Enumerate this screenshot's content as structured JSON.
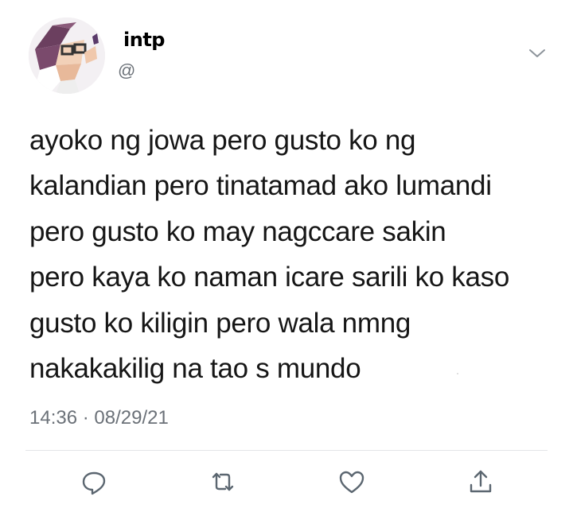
{
  "tweet": {
    "display_name": "intp",
    "handle": "@",
    "text_lines": [
      "ayoko ng jowa pero gusto ko ng",
      "kalandian pero tinatamad ako lumandi",
      "pero gusto ko may nagccare sakin",
      "pero kaya ko naman icare sarili ko kaso",
      "gusto ko kiligin pero wala nmng",
      "nakakakilig na tao s mundo"
    ],
    "time": "14:36",
    "separator": "·",
    "date": "08/29/21"
  },
  "icons": {
    "menu": "chevron-down-icon",
    "reply": "reply-icon",
    "retweet": "retweet-icon",
    "like": "heart-icon",
    "share": "share-icon"
  },
  "colors": {
    "text": "#161616",
    "secondary": "#6b7178",
    "divider": "#e3e5e8",
    "icon": "#5b6670"
  }
}
